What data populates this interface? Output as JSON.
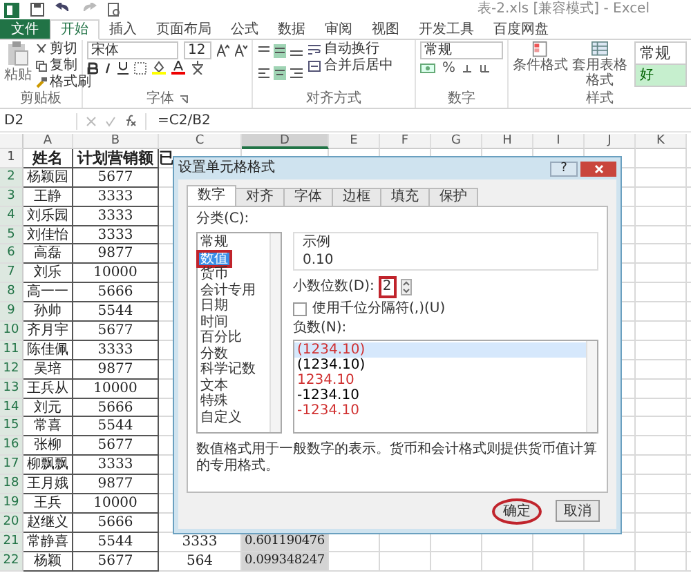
{
  "window": {
    "title": "表-2.xls  [兼容模式] - Excel"
  },
  "tabs": [
    {
      "label": "文件",
      "kind": "file",
      "selected": false
    },
    {
      "label": "开始",
      "kind": "tab",
      "selected": true
    },
    {
      "label": "插入",
      "kind": "tab",
      "selected": false
    },
    {
      "label": "页面布局",
      "kind": "tab",
      "selected": false
    },
    {
      "label": "公式",
      "kind": "tab",
      "selected": false
    },
    {
      "label": "数据",
      "kind": "tab",
      "selected": false
    },
    {
      "label": "审阅",
      "kind": "tab",
      "selected": false
    },
    {
      "label": "视图",
      "kind": "tab",
      "selected": false
    },
    {
      "label": "开发工具",
      "kind": "tab",
      "selected": false
    },
    {
      "label": "百度网盘",
      "kind": "tab",
      "selected": false
    }
  ],
  "clipboard": {
    "paste": "粘贴",
    "cut": "剪切",
    "copy": "复制",
    "painter": "格式刷",
    "label": "剪贴板"
  },
  "font": {
    "name": "宋体",
    "size": "12",
    "label": "字体"
  },
  "alignment": {
    "wrap": "自动换行",
    "merge": "合并后居中",
    "label": "对齐方式"
  },
  "number": {
    "format": "常规",
    "percent": "%",
    "label": "数字"
  },
  "styles": {
    "conditional": "条件格式",
    "table": "套用表格格式",
    "normal": "常规",
    "good": "好",
    "label": "样式"
  },
  "formula_bar": {
    "cell": "D2",
    "formula": "=C2/B2"
  },
  "columns": [
    {
      "label": "A",
      "selected": false
    },
    {
      "label": "B",
      "selected": false
    },
    {
      "label": "C",
      "selected": false
    },
    {
      "label": "D",
      "selected": true
    },
    {
      "label": "E",
      "selected": false
    },
    {
      "label": "F",
      "selected": false
    },
    {
      "label": "G",
      "selected": false
    },
    {
      "label": "H",
      "selected": false
    },
    {
      "label": "I",
      "selected": false
    },
    {
      "label": "J",
      "selected": false
    },
    {
      "label": "K",
      "selected": false
    }
  ],
  "rows": [
    {
      "label": "1",
      "selected": false,
      "a": "姓名",
      "b": "计划营销额",
      "c": "已"
    },
    {
      "label": "2",
      "selected": true,
      "a": "杨颖园",
      "b": "5677"
    },
    {
      "label": "3",
      "selected": true,
      "a": "王静",
      "b": "3333"
    },
    {
      "label": "4",
      "selected": true,
      "a": "刘乐园",
      "b": "3333"
    },
    {
      "label": "5",
      "selected": true,
      "a": "刘佳怡",
      "b": "3333"
    },
    {
      "label": "6",
      "selected": true,
      "a": "高磊",
      "b": "9877"
    },
    {
      "label": "7",
      "selected": true,
      "a": "刘乐",
      "b": "10000"
    },
    {
      "label": "8",
      "selected": true,
      "a": "高一一",
      "b": "5666"
    },
    {
      "label": "9",
      "selected": true,
      "a": "孙帅",
      "b": "5544"
    },
    {
      "label": "10",
      "selected": true,
      "a": "齐月宇",
      "b": "5677"
    },
    {
      "label": "11",
      "selected": true,
      "a": "陈佳佩",
      "b": "3333"
    },
    {
      "label": "12",
      "selected": true,
      "a": "吴培",
      "b": "9877"
    },
    {
      "label": "13",
      "selected": true,
      "a": "王兵从",
      "b": "10000"
    },
    {
      "label": "14",
      "selected": true,
      "a": "刘元",
      "b": "5666"
    },
    {
      "label": "15",
      "selected": true,
      "a": "常喜",
      "b": "5544"
    },
    {
      "label": "16",
      "selected": true,
      "a": "张柳",
      "b": "5677"
    },
    {
      "label": "17",
      "selected": true,
      "a": "柳飘飘",
      "b": "3333"
    },
    {
      "label": "18",
      "selected": true,
      "a": "王月娥",
      "b": "9877"
    },
    {
      "label": "19",
      "selected": true,
      "a": "王兵",
      "b": "10000"
    },
    {
      "label": "20",
      "selected": true,
      "a": "赵继义",
      "b": "5666"
    },
    {
      "label": "21",
      "selected": true,
      "a": "常静喜",
      "b": "5544",
      "c": "3333",
      "d": "0.601190476"
    },
    {
      "label": "22",
      "selected": true,
      "a": "杨颖",
      "b": "5677",
      "c": "564",
      "d": "0.099348247"
    }
  ],
  "dialog": {
    "title": "设置单元格格式",
    "help": "?",
    "tabs": [
      {
        "label": "数字",
        "selected": true
      },
      {
        "label": "对齐",
        "selected": false
      },
      {
        "label": "字体",
        "selected": false
      },
      {
        "label": "边框",
        "selected": false
      },
      {
        "label": "填充",
        "selected": false
      },
      {
        "label": "保护",
        "selected": false
      }
    ],
    "category_label": "分类(C):",
    "categories": [
      {
        "label": "常规",
        "selected": false,
        "highlighted": false
      },
      {
        "label": "数值",
        "selected": true,
        "highlighted": true
      },
      {
        "label": "货币",
        "selected": false,
        "highlighted": false
      },
      {
        "label": "会计专用",
        "selected": false,
        "highlighted": false
      },
      {
        "label": "日期",
        "selected": false,
        "highlighted": false
      },
      {
        "label": "时间",
        "selected": false,
        "highlighted": false
      },
      {
        "label": "百分比",
        "selected": false,
        "highlighted": false
      },
      {
        "label": "分数",
        "selected": false,
        "highlighted": false
      },
      {
        "label": "科学记数",
        "selected": false,
        "highlighted": false
      },
      {
        "label": "文本",
        "selected": false,
        "highlighted": false
      },
      {
        "label": "特殊",
        "selected": false,
        "highlighted": false
      },
      {
        "label": "自定义",
        "selected": false,
        "highlighted": false
      }
    ],
    "sample_label": "示例",
    "sample": "0.10",
    "decimals_label": "小数位数(D):",
    "decimals": "2",
    "decimals_highlighted": true,
    "thousands": {
      "label": "使用千位分隔符(,)(U)",
      "checked": false
    },
    "negative_label": "负数(N):",
    "negatives": [
      {
        "label": "(1234.10)",
        "selected": true,
        "color": "#d03030"
      },
      {
        "label": "(1234.10)",
        "selected": false,
        "color": "#000000"
      },
      {
        "label": "1234.10",
        "selected": false,
        "color": "#d03030"
      },
      {
        "label": "-1234.10",
        "selected": false,
        "color": "#000000"
      },
      {
        "label": "-1234.10",
        "selected": false,
        "color": "#d03030"
      }
    ],
    "description": "数值格式用于一般数字的表示。货币和会计格式则提供货币值计算的专用格式。",
    "buttons": [
      {
        "label": "确定",
        "highlighted": true
      },
      {
        "label": "取消",
        "highlighted": false
      }
    ]
  }
}
